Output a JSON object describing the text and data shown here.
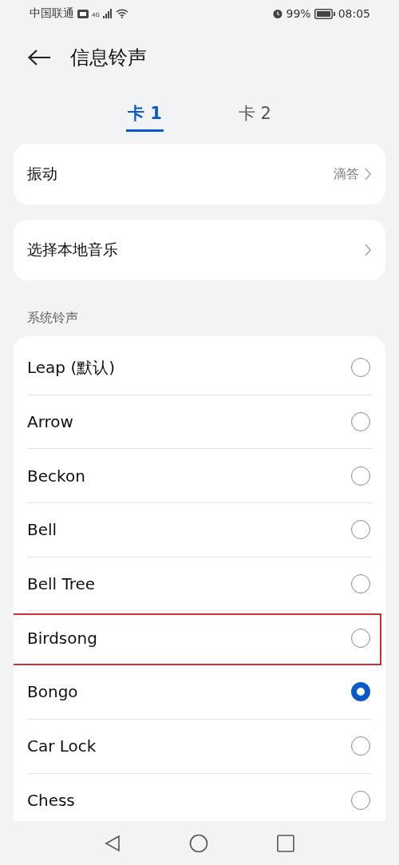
{
  "status_bar": {
    "carrier": "中国联通",
    "network": "4G",
    "battery": "99%",
    "time": "08:05"
  },
  "header": {
    "title": "信息铃声"
  },
  "tabs": [
    {
      "label": "卡 1",
      "selected": true
    },
    {
      "label": "卡 2",
      "selected": false
    }
  ],
  "settings": [
    {
      "label": "振动",
      "value": "滴答"
    },
    {
      "label": "选择本地音乐"
    }
  ],
  "section": {
    "title": "系统铃声"
  },
  "ringtones": [
    {
      "name": "Leap (默认)",
      "selected": false,
      "highlighted": false
    },
    {
      "name": "Arrow",
      "selected": false,
      "highlighted": false
    },
    {
      "name": "Beckon",
      "selected": false,
      "highlighted": false
    },
    {
      "name": "Bell",
      "selected": false,
      "highlighted": false
    },
    {
      "name": "Bell Tree",
      "selected": false,
      "highlighted": false
    },
    {
      "name": "Birdsong",
      "selected": false,
      "highlighted": true
    },
    {
      "name": "Bongo",
      "selected": true,
      "highlighted": false
    },
    {
      "name": "Car Lock",
      "selected": false,
      "highlighted": false
    },
    {
      "name": "Chess",
      "selected": false,
      "highlighted": false
    }
  ]
}
